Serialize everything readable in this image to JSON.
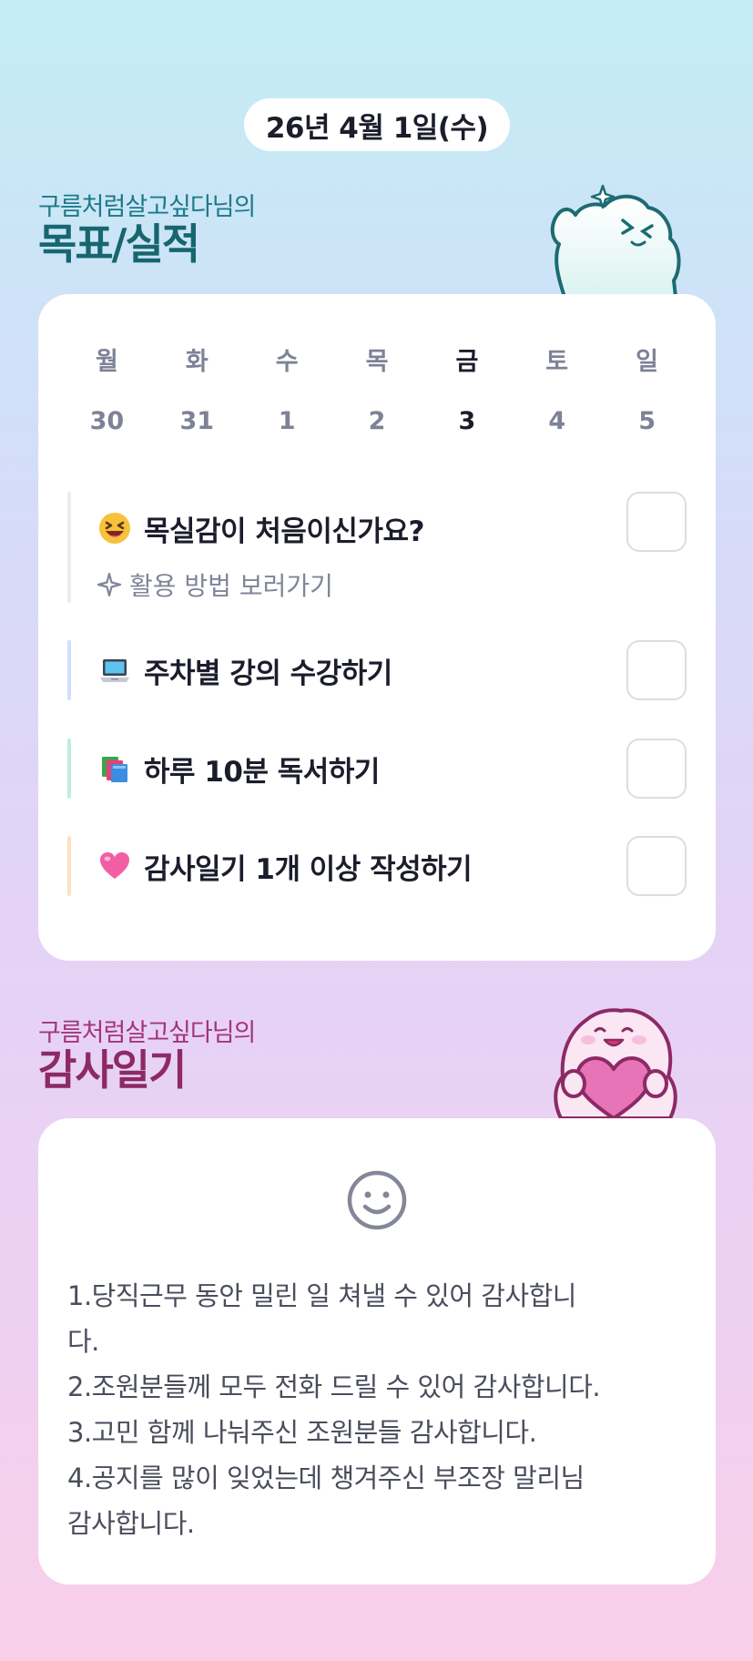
{
  "header": {
    "date": "26년 4월 1일(수)"
  },
  "goals": {
    "owner": "구름처럼살고싶다님의",
    "title": "목표/실적",
    "week": [
      {
        "day": "월",
        "date": "30"
      },
      {
        "day": "화",
        "date": "31"
      },
      {
        "day": "수",
        "date": "1"
      },
      {
        "day": "목",
        "date": "2"
      },
      {
        "day": "금",
        "date": "3"
      },
      {
        "day": "토",
        "date": "4"
      },
      {
        "day": "일",
        "date": "5"
      }
    ],
    "items": [
      {
        "emoji": "grinning-squinting-face-icon",
        "label": "목실감이 처음이신가요?",
        "checked": false,
        "bar_color": "#ececef",
        "guide": "활용 방법 보러가기"
      },
      {
        "emoji": "laptop-icon",
        "label": "주차별 강의 수강하기",
        "checked": false,
        "bar_color": "#cfe0fa"
      },
      {
        "emoji": "books-icon",
        "label": "하루 10분 독서하기",
        "checked": false,
        "bar_color": "#bfeedd"
      },
      {
        "emoji": "pink-heart-icon",
        "label": "감사일기 1개 이상 작성하기",
        "checked": false,
        "bar_color": "#fbe3c2"
      }
    ]
  },
  "diary": {
    "owner": "구름처럼살고싶다님의",
    "title": "감사일기",
    "mood_icon": "smile-face-icon",
    "text": "1.당직근무 동안 밀린 일 쳐낼 수 있어 감사합니\n다.\n2.조원분들께 모두 전화 드릴 수 있어 감사합니다.\n3.고민 함께 나눠주신 조원분들 감사합니다.\n4.공지를 많이 잊었는데 챙겨주신 부조장 말리님\n감사합니다."
  },
  "colors": {
    "goals_title": "#17666f",
    "diary_title": "#8c2a66",
    "active_day": "#1b1d2b",
    "inactive_day": "#7d8296"
  }
}
